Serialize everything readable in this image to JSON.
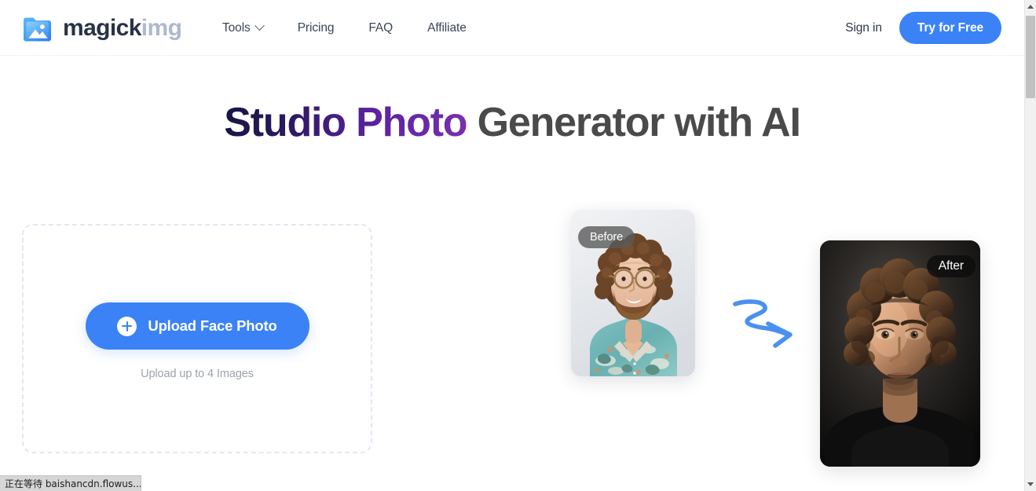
{
  "header": {
    "logo": {
      "icon": "image-folder-icon",
      "text_primary": "magick",
      "text_secondary": "img"
    },
    "nav_items": [
      {
        "label": "Tools",
        "has_dropdown": true,
        "icon": "chevron-down-icon"
      },
      {
        "label": "Pricing",
        "has_dropdown": false
      },
      {
        "label": "FAQ",
        "has_dropdown": false
      },
      {
        "label": "Affiliate",
        "has_dropdown": false
      }
    ],
    "sign_in_label": "Sign in",
    "cta_label": "Try for Free",
    "cta_color": "#3b82f6"
  },
  "hero": {
    "title_gradient_part": "Studio Photo",
    "title_plain_part": " Generator with AI",
    "gradient_start_color": "#151544",
    "gradient_end_color": "#7a2fb0",
    "plain_color": "#4a4a4a"
  },
  "uploader": {
    "button_label": "Upload Face Photo",
    "button_icon": "plus-circle-icon",
    "hint": "Upload up to 4 Images",
    "button_color": "#3b82f6",
    "border_color": "#e2e8f2"
  },
  "showcase": {
    "before": {
      "badge": "Before",
      "badge_color": "#5a5a5a",
      "alt": "Man with curly hair, glasses and beard in teal hawaiian shirt on light gray background"
    },
    "after": {
      "badge": "After",
      "badge_color": "#0c0c0c",
      "alt": "Studio portrait of man with curly hair in black t-shirt on dark background"
    },
    "arrow_icon": "squiggly-arrow-right-icon",
    "arrow_color": "#4a90f0"
  },
  "browser": {
    "status_text": "正在等待 baishancdn.flowus....",
    "scrollbar": {
      "up_icon": "scroll-up-arrow-icon",
      "down_icon": "scroll-down-arrow-icon"
    }
  }
}
